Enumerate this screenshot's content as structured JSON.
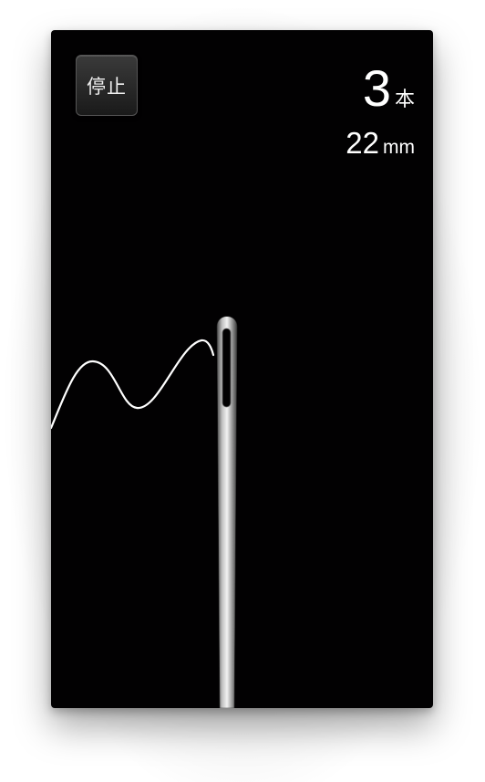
{
  "controls": {
    "stop_label": "停止"
  },
  "counter": {
    "value": "3",
    "unit": "本"
  },
  "length": {
    "value": "22",
    "unit": "mm"
  },
  "colors": {
    "background": "#020102",
    "thread": "#ffffff",
    "needle": "#c8c8c8"
  },
  "scene": {
    "thread_icon": "thread-curve",
    "needle_icon": "sewing-needle"
  }
}
